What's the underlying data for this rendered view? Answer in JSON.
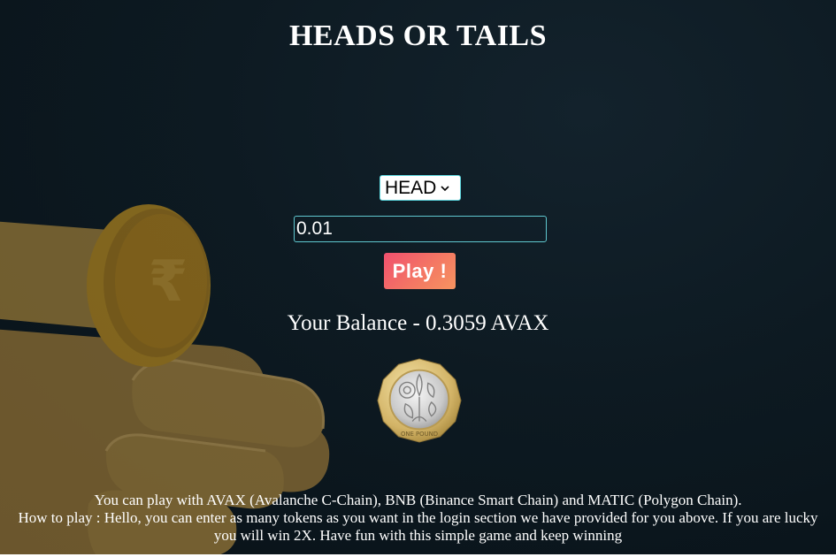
{
  "header": {
    "title": "HEADS OR TAILS"
  },
  "game": {
    "side_select": {
      "selected": "HEAD"
    },
    "amount_input": {
      "value": "0.01"
    },
    "play_label": "Play !",
    "balance_text": "Your Balance - 0.3059 AVAX",
    "coin_image": {
      "icon": "one-pound-coin-icon",
      "inscription": "ONE POUND"
    }
  },
  "footer": {
    "line1": "You can play with AVAX (Avalanche C-Chain), BNB (Binance Smart Chain) and MATIC (Polygon Chain).",
    "line2": "How to play : Hello, you can enter as many tokens as you want in the login section we have provided for you above. If you are lucky",
    "line3": "you will win 2X. Have fun with this simple game and keep winning"
  },
  "background": {
    "icon": "hand-flipping-rupee-coin-illustration",
    "coin_symbol": "₹"
  },
  "colors": {
    "background": "#0d1a22",
    "accent_border": "#5cd6de",
    "play_gradient_start": "#f0506e",
    "play_gradient_end": "#f69460",
    "hand": "#b08a3c",
    "rupee_coin": "#c9951e"
  }
}
